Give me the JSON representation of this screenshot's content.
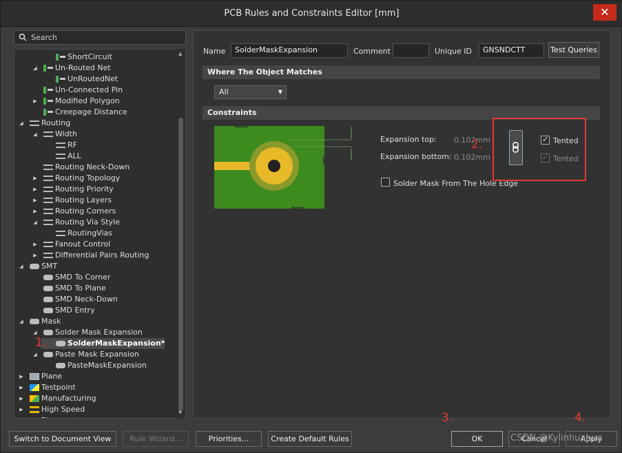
{
  "window": {
    "title": "PCB Rules and Constraints Editor [mm]"
  },
  "search": {
    "placeholder": "Search"
  },
  "tree": [
    {
      "label": "ShortCircuit",
      "indent": 3,
      "arrow": "",
      "icon": "net"
    },
    {
      "label": "Un-Routed Net",
      "indent": 2,
      "arrow": "down",
      "icon": "net"
    },
    {
      "label": "UnRoutedNet",
      "indent": 3,
      "arrow": "",
      "icon": "net"
    },
    {
      "label": "Un-Connected Pin",
      "indent": 2,
      "arrow": "",
      "icon": "net"
    },
    {
      "label": "Modified Polygon",
      "indent": 2,
      "arrow": "right",
      "icon": "net"
    },
    {
      "label": "Creepage Distance",
      "indent": 2,
      "arrow": "",
      "icon": "net"
    },
    {
      "label": "Routing",
      "indent": 1,
      "arrow": "down",
      "icon": "route"
    },
    {
      "label": "Width",
      "indent": 2,
      "arrow": "down",
      "icon": "route"
    },
    {
      "label": "RF",
      "indent": 3,
      "arrow": "",
      "icon": "route"
    },
    {
      "label": "ALL",
      "indent": 3,
      "arrow": "",
      "icon": "route"
    },
    {
      "label": "Routing Neck-Down",
      "indent": 2,
      "arrow": "",
      "icon": "route"
    },
    {
      "label": "Routing Topology",
      "indent": 2,
      "arrow": "right",
      "icon": "route"
    },
    {
      "label": "Routing Priority",
      "indent": 2,
      "arrow": "right",
      "icon": "route"
    },
    {
      "label": "Routing Layers",
      "indent": 2,
      "arrow": "right",
      "icon": "route"
    },
    {
      "label": "Routing Corners",
      "indent": 2,
      "arrow": "right",
      "icon": "route"
    },
    {
      "label": "Routing Via Style",
      "indent": 2,
      "arrow": "down",
      "icon": "route"
    },
    {
      "label": "RoutingVias",
      "indent": 3,
      "arrow": "",
      "icon": "route"
    },
    {
      "label": "Fanout Control",
      "indent": 2,
      "arrow": "right",
      "icon": "route"
    },
    {
      "label": "Differential Pairs Routing",
      "indent": 2,
      "arrow": "right",
      "icon": "route"
    },
    {
      "label": "SMT",
      "indent": 1,
      "arrow": "down",
      "icon": "pad"
    },
    {
      "label": "SMD To Corner",
      "indent": 2,
      "arrow": "",
      "icon": "pad"
    },
    {
      "label": "SMD To Plane",
      "indent": 2,
      "arrow": "",
      "icon": "pad"
    },
    {
      "label": "SMD Neck-Down",
      "indent": 2,
      "arrow": "",
      "icon": "pad"
    },
    {
      "label": "SMD Entry",
      "indent": 2,
      "arrow": "",
      "icon": "pad"
    },
    {
      "label": "Mask",
      "indent": 1,
      "arrow": "down",
      "icon": "pad"
    },
    {
      "label": "Solder Mask Expansion",
      "indent": 2,
      "arrow": "down",
      "icon": "pad"
    },
    {
      "label": "SolderMaskExpansion*",
      "indent": 3,
      "arrow": "",
      "icon": "pad",
      "selected": true
    },
    {
      "label": "Paste Mask Expansion",
      "indent": 2,
      "arrow": "down",
      "icon": "pad"
    },
    {
      "label": "PasteMaskExpansion",
      "indent": 3,
      "arrow": "",
      "icon": "pad"
    },
    {
      "label": "Plane",
      "indent": 1,
      "arrow": "right",
      "icon": "plane"
    },
    {
      "label": "Testpoint",
      "indent": 1,
      "arrow": "right",
      "icon": "tp"
    },
    {
      "label": "Manufacturing",
      "indent": 1,
      "arrow": "right",
      "icon": "mfg"
    },
    {
      "label": "High Speed",
      "indent": 1,
      "arrow": "right",
      "icon": "hs"
    },
    {
      "label": "Placement",
      "indent": 1,
      "arrow": "right",
      "icon": "pad"
    }
  ],
  "rule": {
    "name_label": "Name",
    "name_value": "SolderMaskExpansion",
    "comment_label": "Comment",
    "comment_value": "",
    "uid_label": "Unique ID",
    "uid_value": "GNSNDCTT",
    "test_queries": "Test Queries"
  },
  "where_header": "Where The Object Matches",
  "where_dropdown": "All",
  "constraints_header": "Constraints",
  "constraints": {
    "exp_top_label": "Expansion top:",
    "exp_top_value": "0.102mm",
    "exp_bottom_label": "Expansion bottom:",
    "exp_bottom_value": "0.102mm",
    "tented_top": "Tented",
    "tented_bottom": "Tented",
    "hole_edge_label": "Solder Mask From The Hole Edge"
  },
  "annotations": {
    "m1": "1.",
    "m2": "2.",
    "m3": "3.",
    "m4": "4."
  },
  "footer": {
    "switch_view": "Switch to Document View",
    "rule_wizard": "Rule Wizard...",
    "priorities": "Priorities...",
    "create_default": "Create Default Rules",
    "ok": "OK",
    "cancel": "Cancel",
    "apply": "Apply"
  },
  "watermark": "CSDN @Kylinhuahua",
  "colors": {
    "board_green": "#3d8a1f",
    "pad_yellow": "#e8b928",
    "annotation_red": "#e53935"
  }
}
